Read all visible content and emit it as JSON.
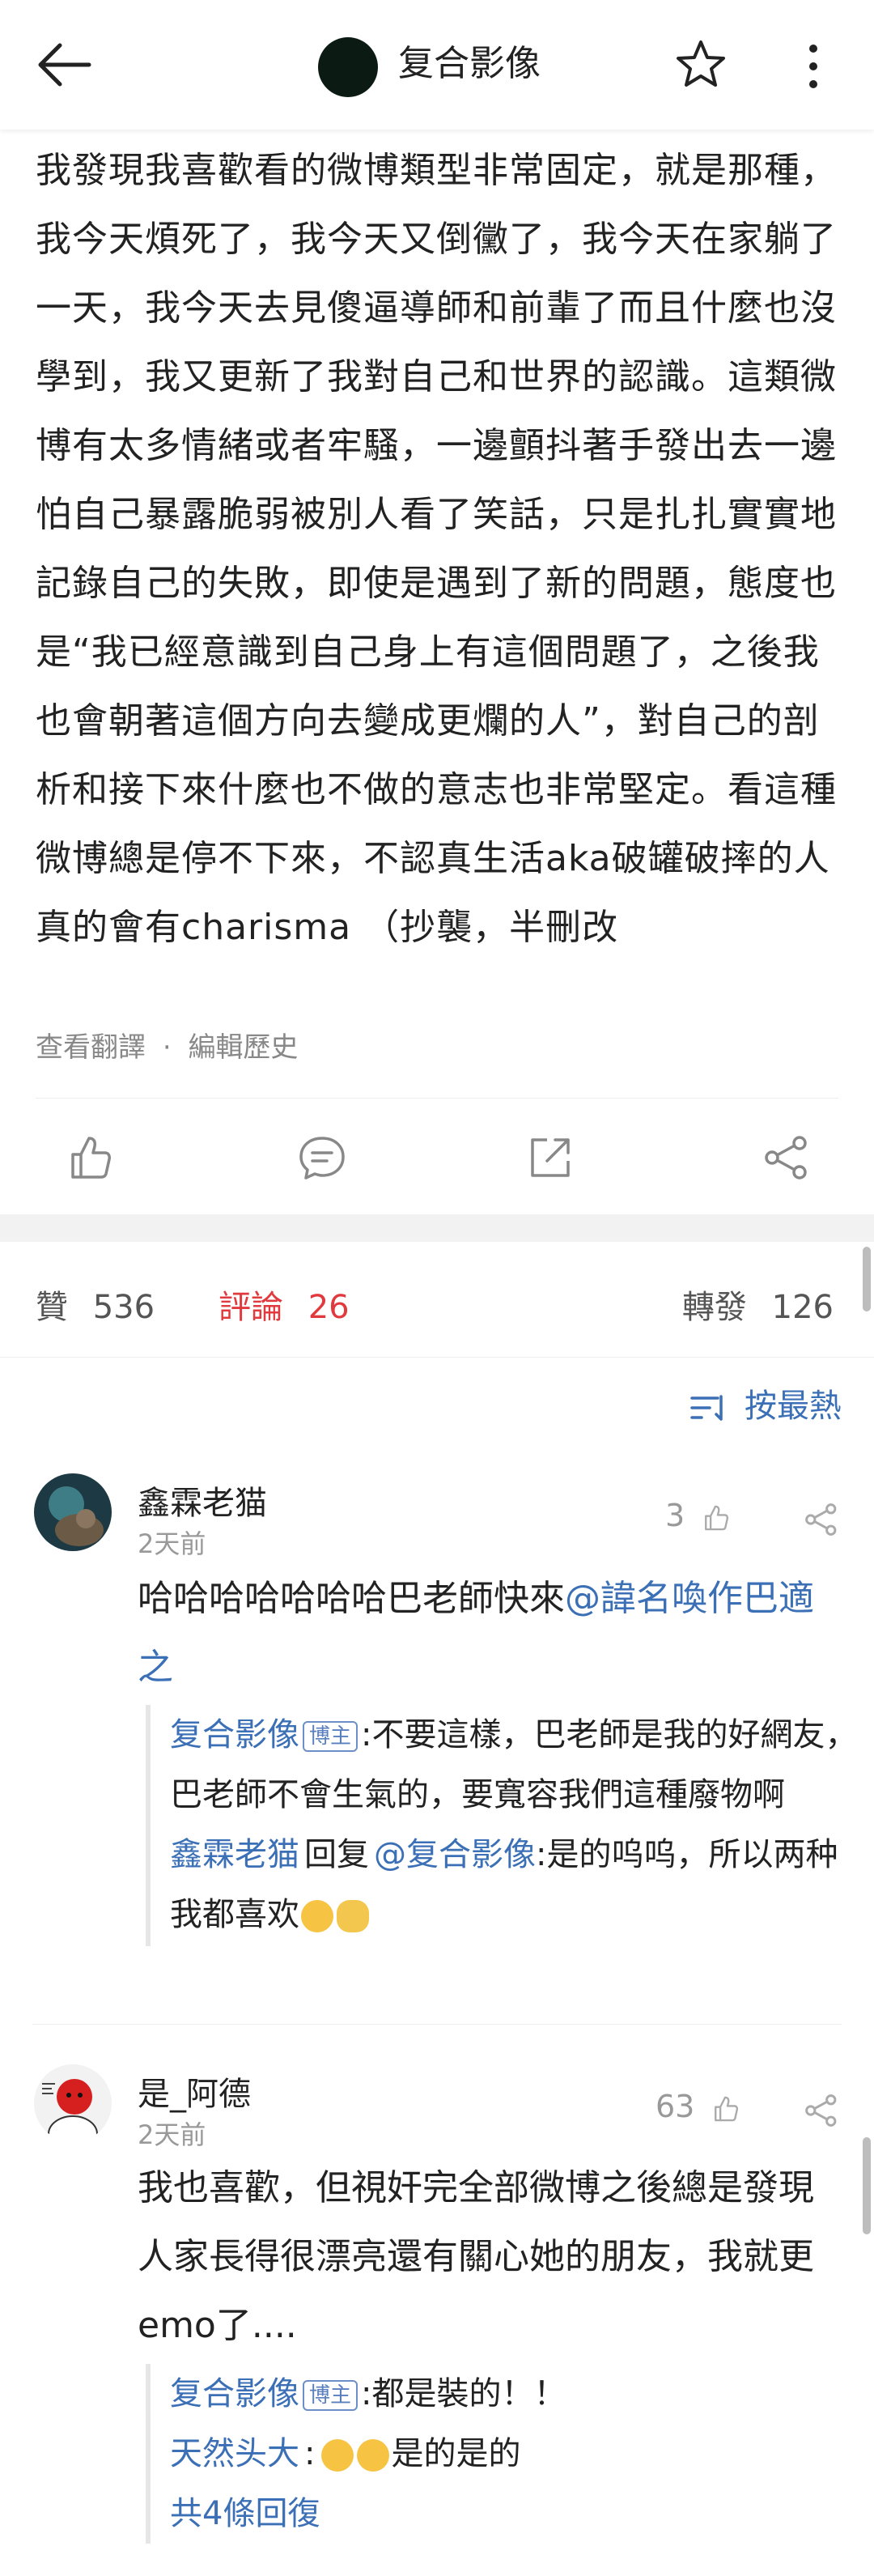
{
  "header": {
    "title": "复合影像",
    "avatar_color": "#0b1b14"
  },
  "post": {
    "text": "我發現我喜歡看的微博類型非常固定，就是那種，我今天煩死了，我今天又倒黴了，我今天在家躺了一天，我今天去見傻逼導師和前輩了而且什麼也沒學到，我又更新了我對自己和世界的認識。這類微博有太多情緒或者牢騷，一邊顫抖著手發出去一邊怕自己暴露脆弱被別人看了笑話，只是扎扎實實地記錄自己的失敗，即使是遇到了新的問題，態度也是“我已經意識到自己身上有這個問題了，之後我也會朝著這個方向去變成更爛的人”，對自己的剖析和接下來什麼也不做的意志也非常堅定。看這種微博總是停不下來，不認真生活aka破罐破摔的人真的會有charisma （抄襲，半刪改",
    "view_translation": "查看翻譯",
    "dot": "·",
    "edit_history": "編輯歷史"
  },
  "stats": {
    "likes_label": "贊",
    "likes": "536",
    "comments_label": "評論",
    "comments": "26",
    "reposts_label": "轉發",
    "reposts": "126"
  },
  "sort_label": "按最熱",
  "comments": [
    {
      "name": "鑫霖老猫",
      "time": "2天前",
      "likes": "3",
      "text": "哈哈哈哈哈哈哈巴老師快來",
      "mention": "@諱名喚作巴適之",
      "replies": [
        {
          "name": "复合影像",
          "badge": "博主",
          "text": ":不要這樣，巴老師是我的好網友，巴老師不會生氣的，要寬容我們這種廢物啊"
        },
        {
          "name": "鑫霖老猫",
          "reply_word": "回复",
          "mention": "@复合影像",
          "text": ":是的呜呜，所以两种我都喜欢"
        }
      ]
    },
    {
      "name": "是_阿德",
      "time": "2天前",
      "likes": "63",
      "text": "我也喜歡，但視奸完全部微博之後總是發現人家長得很漂亮還有關心她的朋友，我就更emo了....",
      "replies": [
        {
          "name": "复合影像",
          "badge": "博主",
          "text": ":都是裝的！！"
        },
        {
          "name": "天然头大",
          "text": "是的是的"
        }
      ],
      "more_replies": "共4條回復"
    }
  ],
  "colors": {
    "accent_blue": "#3b6fb6",
    "accent_red": "#e03a3e"
  }
}
